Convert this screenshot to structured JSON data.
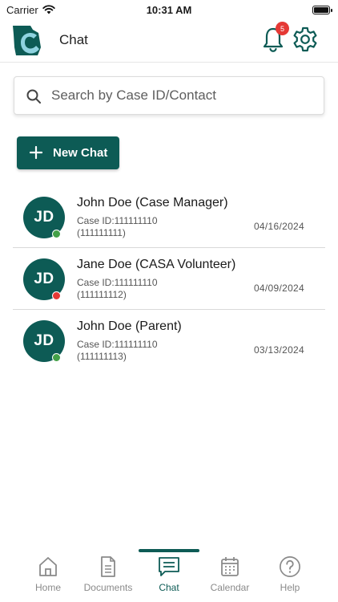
{
  "status_bar": {
    "carrier": "Carrier",
    "time": "10:31 AM"
  },
  "header": {
    "title": "Chat",
    "notification_count": "5"
  },
  "search": {
    "placeholder": "Search by Case ID/Contact",
    "value": ""
  },
  "new_chat": {
    "label": "New Chat"
  },
  "chats": [
    {
      "initials": "JD",
      "name": "John Doe (Case Manager)",
      "case_id": "Case ID:111111110",
      "sub_id": "(111111111)",
      "date": "04/16/2024",
      "status": "online",
      "status_color": "#43a047"
    },
    {
      "initials": "JD",
      "name": "Jane Doe (CASA Volunteer)",
      "case_id": "Case ID:111111110",
      "sub_id": "(111111112)",
      "date": "04/09/2024",
      "status": "offline",
      "status_color": "#e53935"
    },
    {
      "initials": "JD",
      "name": "John Doe (Parent)",
      "case_id": "Case ID:111111110",
      "sub_id": "(111111113)",
      "date": "03/13/2024",
      "status": "online",
      "status_color": "#43a047"
    }
  ],
  "tabs": [
    {
      "label": "Home",
      "icon": "home-icon",
      "active": false
    },
    {
      "label": "Documents",
      "icon": "document-icon",
      "active": false
    },
    {
      "label": "Chat",
      "icon": "chat-icon",
      "active": true
    },
    {
      "label": "Calendar",
      "icon": "calendar-icon",
      "active": false
    },
    {
      "label": "Help",
      "icon": "help-icon",
      "active": false
    }
  ],
  "colors": {
    "brand": "#0d5b55",
    "online": "#43a047",
    "offline": "#e53935",
    "badge": "#e53935"
  }
}
